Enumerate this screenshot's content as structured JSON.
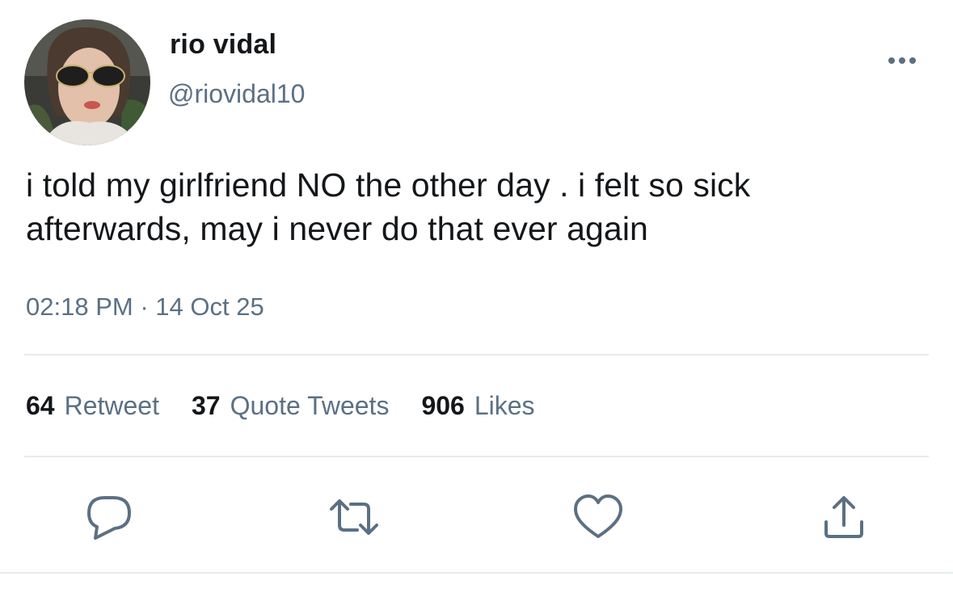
{
  "tweet": {
    "author": {
      "display_name": "rio vidal",
      "handle": "@riovidal10",
      "avatar": "profile-photo"
    },
    "text": "i told my girlfriend NO the other day . i felt so sick afterwards, may i never do that ever again",
    "time": "02:18 PM",
    "separator": "·",
    "date": "14 Oct 25",
    "stats": [
      {
        "count": "64",
        "label": "Retweet"
      },
      {
        "count": "37",
        "label": "Quote Tweets"
      },
      {
        "count": "906",
        "label": "Likes"
      }
    ],
    "actions": [
      {
        "icon": "reply-icon"
      },
      {
        "icon": "retweet-icon"
      },
      {
        "icon": "like-icon"
      },
      {
        "icon": "share-icon"
      }
    ],
    "more_icon": "more-icon"
  },
  "colors": {
    "primary_text": "#14171a",
    "secondary_text": "#5b7083",
    "divider": "#e6ecf0",
    "icon": "#5b7083"
  }
}
